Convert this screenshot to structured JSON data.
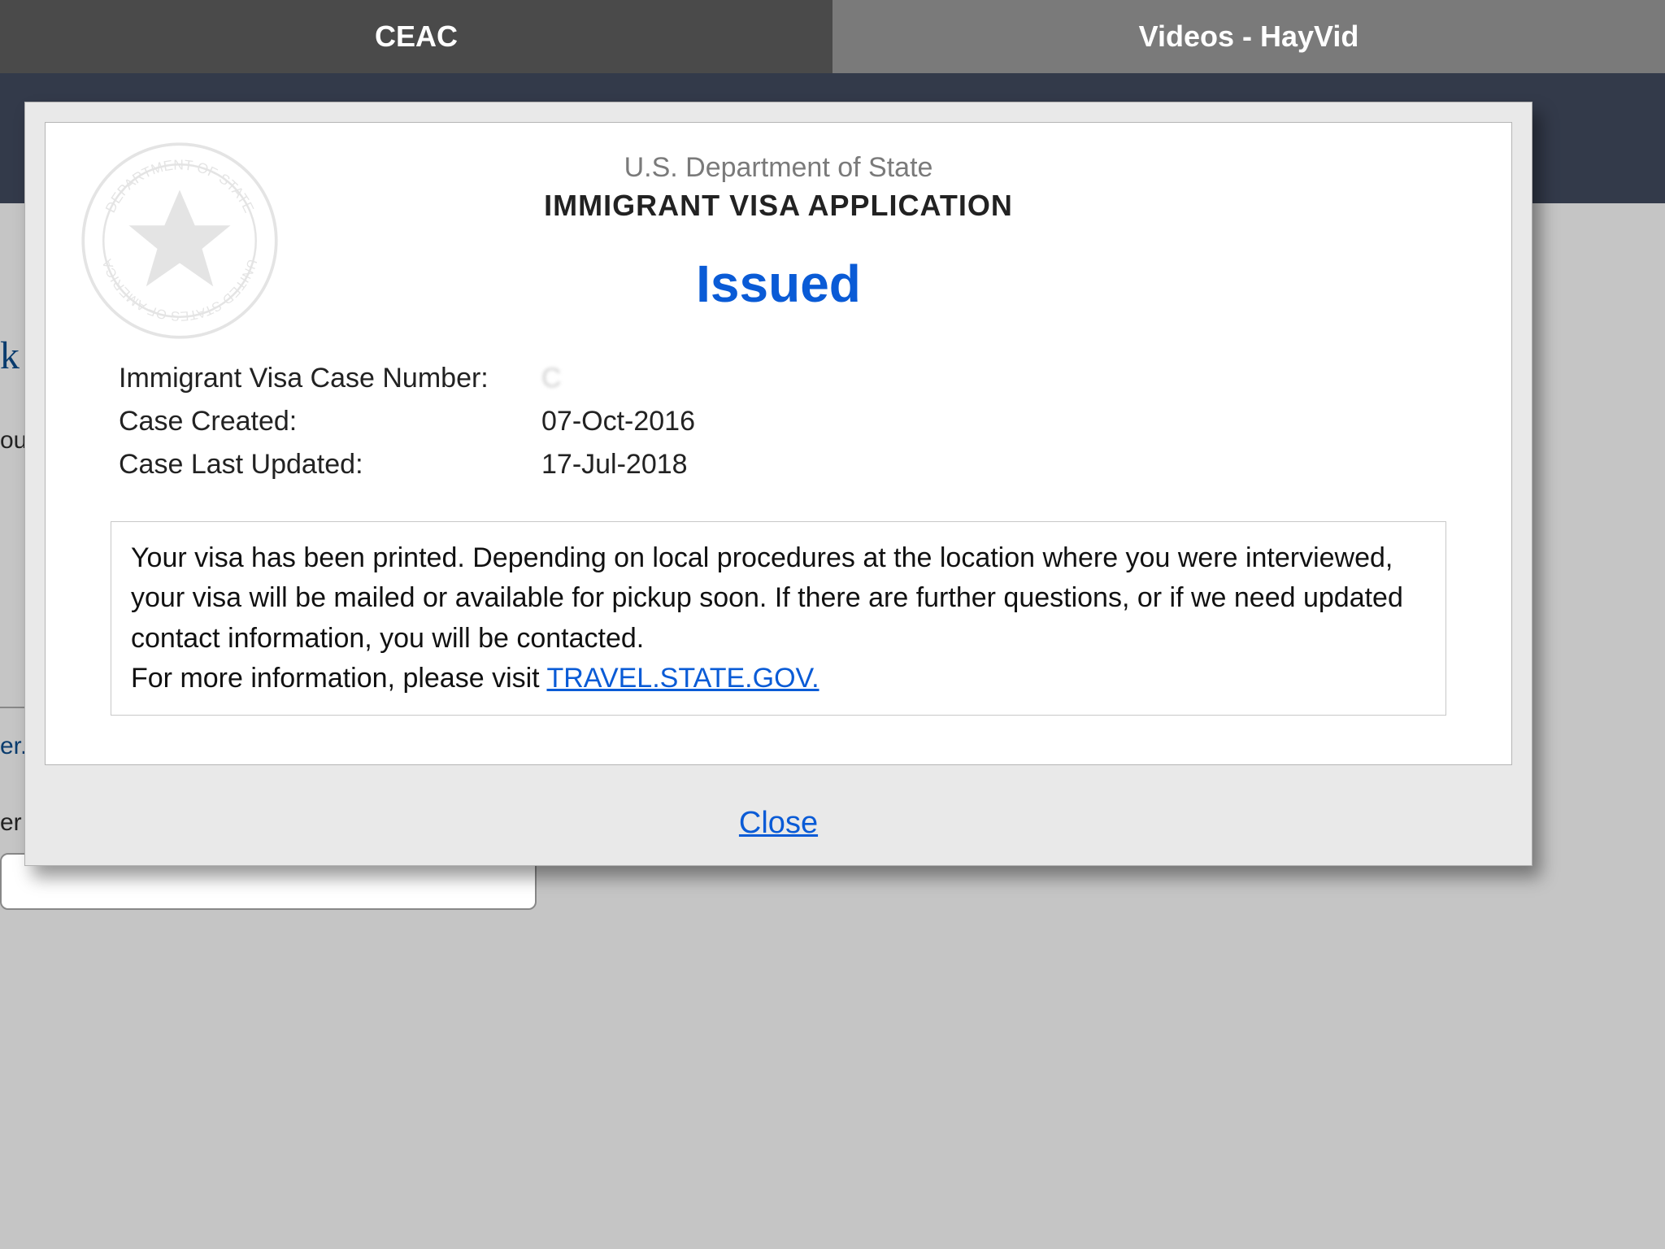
{
  "tabs": {
    "left": "CEAC",
    "right": "Videos - HayVid"
  },
  "background": {
    "heading_fragment": "k",
    "line1_fragment": "ou",
    "line2_fragment": "er.",
    "label_fragment": "er"
  },
  "modal": {
    "dept": "U.S. Department of State",
    "title": "IMMIGRANT VISA APPLICATION",
    "status": "Issued",
    "fields": {
      "case_number_label": "Immigrant Visa Case Number:",
      "case_number_value": "C",
      "case_created_label": "Case Created:",
      "case_created_value": "07-Oct-2016",
      "case_updated_label": "Case Last Updated:",
      "case_updated_value": "17-Jul-2018"
    },
    "message": {
      "body": "Your visa has been printed. Depending on local procedures at the location where you were interviewed, your visa will be mailed or available for pickup soon. If there are further questions, or if we need updated contact information, you will be contacted.",
      "more_info_prefix": "For more information, please visit ",
      "link_text": "TRAVEL.STATE.GOV."
    },
    "close": "Close"
  }
}
